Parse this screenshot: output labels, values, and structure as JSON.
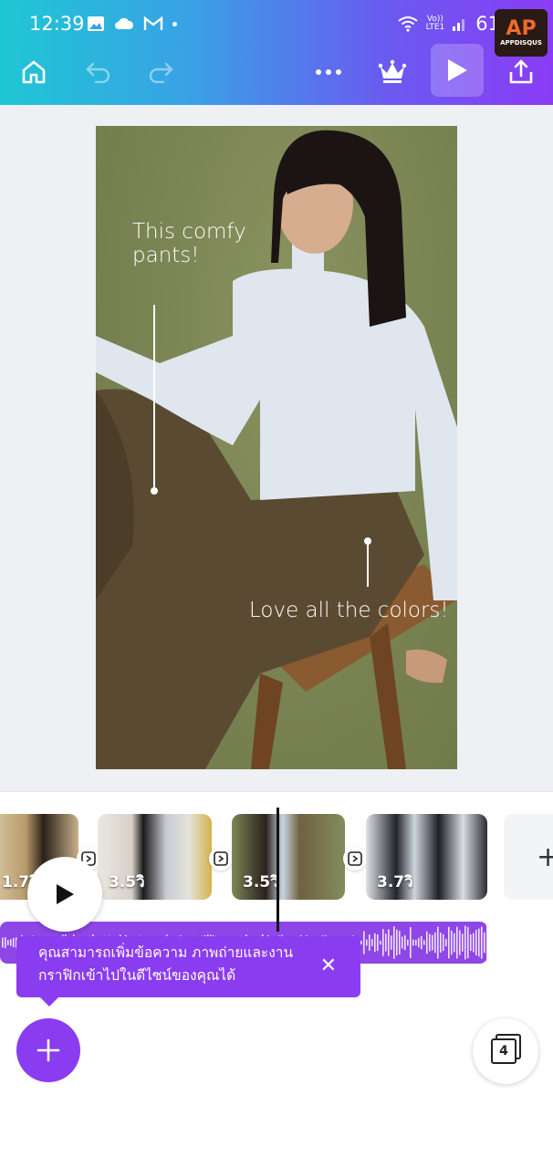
{
  "status_bar": {
    "time": "12:39",
    "network_label": "Vo))\nLTE1",
    "battery_percent": "61"
  },
  "watermark": {
    "top": "AP",
    "bottom": "APPDISQUS"
  },
  "toolbar": {
    "home_icon": "home-icon",
    "undo_icon": "undo-icon",
    "redo_icon": "redo-icon",
    "more_icon": "more-horizontal-icon",
    "premium_icon": "crown-icon",
    "play_icon": "play-icon",
    "share_icon": "share-icon"
  },
  "design": {
    "caption_1": "This comfy pants!",
    "caption_2": "Love all the colors!"
  },
  "timeline": {
    "clips": [
      {
        "duration": "1.7วิ"
      },
      {
        "duration": "3.5วิ"
      },
      {
        "duration": "3.5วิ"
      },
      {
        "duration": "3.7วิ"
      }
    ],
    "add_clip_label": "+"
  },
  "tooltip": {
    "text": "คุณสามารถเพิ่มข้อความ ภาพถ่ายและงานกราฟิกเข้าไปในดีไซน์ของคุณได้",
    "close": "✕"
  },
  "pages": {
    "count": "4"
  },
  "colors": {
    "accent": "#8a3cf0",
    "audio_track": "#8f46e6"
  }
}
